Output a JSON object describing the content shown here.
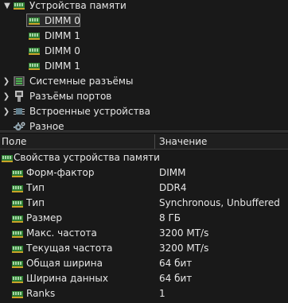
{
  "tree": {
    "memory_devices": "Устройства памяти",
    "dimms": [
      "DIMM 0",
      "DIMM 1",
      "DIMM 0",
      "DIMM 1"
    ],
    "system_slots": "Системные разъёмы",
    "port_connectors": "Разъёмы портов",
    "onboard_devices": "Встроенные устройства",
    "misc": "Разное"
  },
  "columns": {
    "field": "Поле",
    "value": "Значение"
  },
  "group": {
    "title": "Свойства устройства памяти"
  },
  "properties": [
    {
      "name": "Форм-фактор",
      "value": "DIMM"
    },
    {
      "name": "Тип",
      "value": "DDR4"
    },
    {
      "name": "Тип",
      "value": "Synchronous, Unbuffered"
    },
    {
      "name": "Размер",
      "value": "8 ГБ"
    },
    {
      "name": "Макс. частота",
      "value": "3200 MT/s"
    },
    {
      "name": "Текущая частота",
      "value": "3200 MT/s"
    },
    {
      "name": "Общая ширина",
      "value": "64 бит"
    },
    {
      "name": "Ширина данных",
      "value": "64 бит"
    },
    {
      "name": "Ranks",
      "value": "1"
    }
  ]
}
